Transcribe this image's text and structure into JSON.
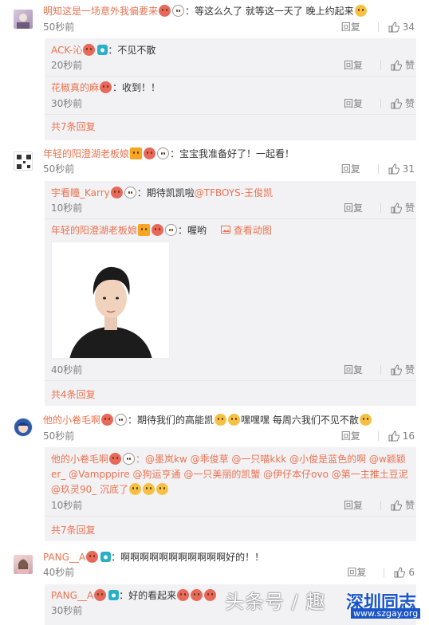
{
  "colors": {
    "username": "#eb7350",
    "muted": "#808080",
    "subbox": "#f2f2f5"
  },
  "icons": {
    "like": "thumbs-up-icon",
    "vip": "crown-icon",
    "verify": "camera-badge-icon",
    "panda": "panda-icon"
  },
  "comments": [
    {
      "username": "明知这是一场意外我偏要来",
      "text": "：等这么久了 就等这一天了 晚上约起来",
      "time": "50秒前",
      "reply": "回复",
      "likes": "34",
      "replies": [
        {
          "username": "ACK-沁",
          "text": "：不见不散",
          "time": "20秒前",
          "reply": "回复",
          "likes": "赞"
        },
        {
          "username": "花椒真的麻",
          "text": "：收到！！",
          "time": "30秒前",
          "reply": "回复",
          "likes": "赞"
        }
      ],
      "more": "共7条回复"
    },
    {
      "username": "年轻的阳澄湖老板娘",
      "text": "：宝宝我准备好了！一起看！",
      "time": "50秒前",
      "reply": "回复",
      "likes": "31",
      "replies": [
        {
          "username": "宇看瞳_Karry",
          "text": "：期待凯凯啦",
          "mention": "@TFBOYS-王俊凯",
          "time": "10秒前",
          "reply": "回复",
          "likes": "赞"
        },
        {
          "username": "年轻的阳澄湖老板娘",
          "text": "：喔哟",
          "view_gif": "查看动图",
          "time": "40秒前",
          "reply": "回复",
          "likes": "赞"
        }
      ],
      "more": "共4条回复"
    },
    {
      "username": "他的小卷毛啊",
      "text": "：期待我们的高能凯",
      "text2": "嘿嘿嘿 每周六我们不见不散",
      "time": "50秒前",
      "reply": "回复",
      "likes": "16",
      "replies": [
        {
          "username": "他的小卷毛啊",
          "line1": "：@墨岚kw @乖俊草 @一只喵kkk @小俊是蓝色的啊 @w颖颖",
          "line2": "er_ @Vampppire @狗运亨通 @一只美丽的凯蟹 @伊仔本仔ovo @第一主推土豆泥",
          "line3": "@玖灵90_ 沉底了",
          "time": "10秒前",
          "reply": "回复",
          "likes": "赞"
        }
      ],
      "more": "共7条回复"
    },
    {
      "username": "PANG__A",
      "text": "：啊啊啊啊啊啊啊啊啊啊啊好的！！",
      "time": "40秒前",
      "reply": "回复",
      "likes": "6",
      "replies": [
        {
          "username": "PANG__A",
          "text": "：好的看起来",
          "time": "30秒前",
          "reply": "回复",
          "likes": "赞"
        }
      ]
    }
  ],
  "watermark": {
    "text": "头条号 / 趣",
    "brand": "深圳同志",
    "url": "www.szgay.org"
  }
}
